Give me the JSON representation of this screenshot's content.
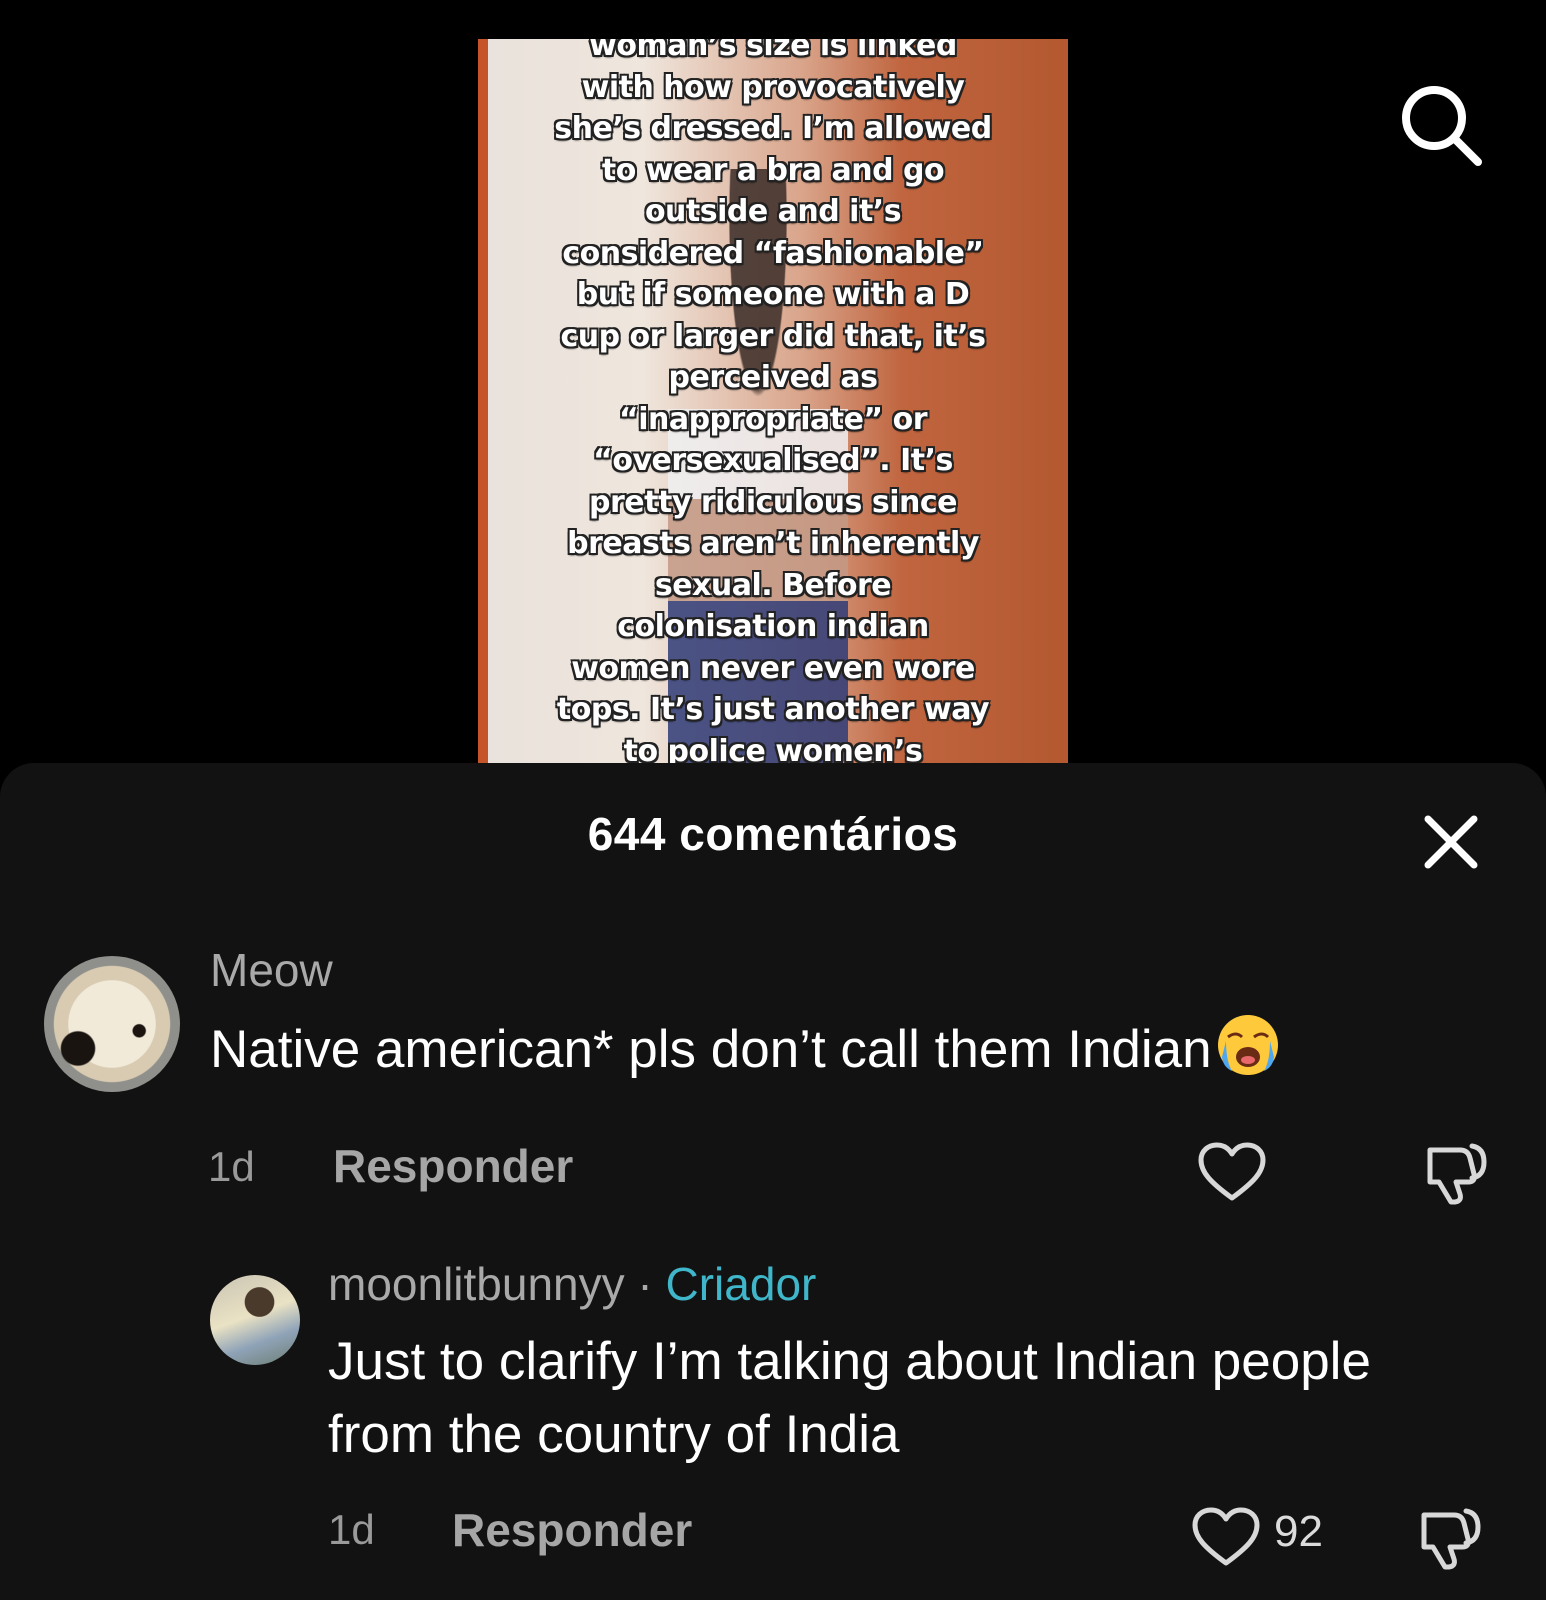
{
  "video": {
    "overlay_text": "woman’s size is linked\nwith how provocatively\nshe’s dressed. I’m allowed\nto wear a bra and go\noutside and it’s\nconsidered “fashionable”\nbut if someone with a D\ncup or larger did that, it’s\nperceived as\n“inappropriate” or\n“oversexualised”. It’s\npretty ridiculous since\nbreasts aren’t inherently\nsexual. Before\ncolonisation indian\nwomen never even wore\ntops. It’s just another way\nto police women’s",
    "search_icon": "search-icon"
  },
  "panel": {
    "title": "644 comentários",
    "close_icon": "close-icon"
  },
  "comments": [
    {
      "username": "Meow",
      "text": "Native american* pls don’t call them Indian",
      "emoji": "loudly-crying-face-emoji",
      "time": "1d",
      "reply_label": "Responder",
      "likes": ""
    },
    {
      "username": "moonlitbunnyy",
      "separator": "·",
      "badge": "Criador",
      "text": "Just to clarify I’m talking about Indian people from the country of India",
      "time": "1d",
      "reply_label": "Responder",
      "likes": "92"
    }
  ],
  "colors": {
    "panel_bg": "#121212",
    "creator_badge": "#3fb6c9",
    "muted_text": "#a9a9a9"
  }
}
